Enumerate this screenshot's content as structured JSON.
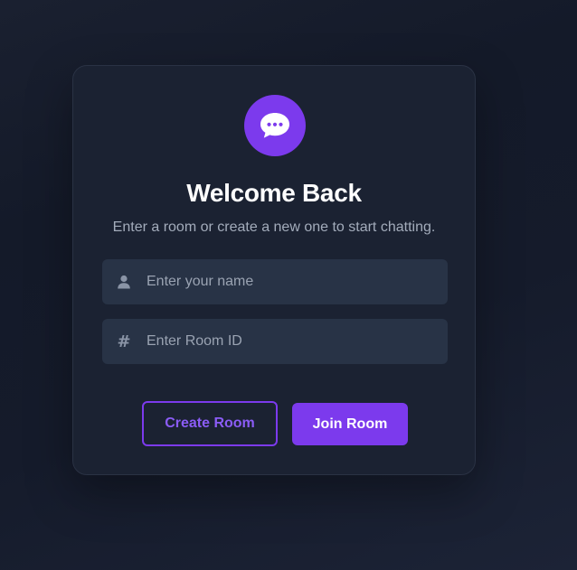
{
  "card": {
    "title": "Welcome Back",
    "subtitle": "Enter a room or create a new one to start chatting."
  },
  "fields": {
    "name": {
      "placeholder": "Enter your name",
      "value": "",
      "icon": "user-icon"
    },
    "room": {
      "placeholder": "Enter Room ID",
      "value": "",
      "icon": "hash-icon",
      "icon_glyph": "#"
    }
  },
  "buttons": {
    "create_label": "Create Room",
    "join_label": "Join Room"
  },
  "logo": {
    "icon": "chat-bubble-icon"
  },
  "colors": {
    "accent": "#7c3aed",
    "card_bg": "#1b2232",
    "input_bg": "#283346",
    "page_bg": "#151b2b"
  }
}
